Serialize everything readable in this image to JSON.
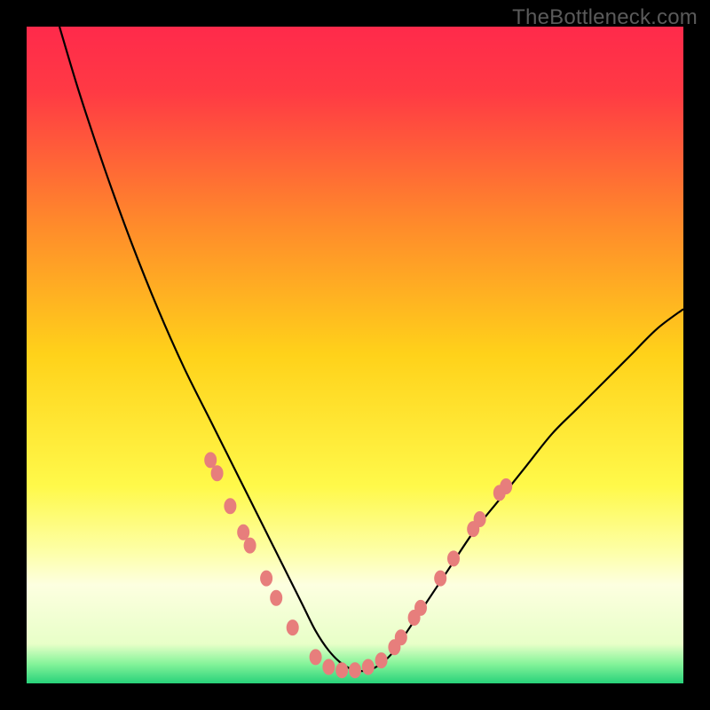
{
  "watermark": "TheBottleneck.com",
  "chart_data": {
    "type": "line",
    "title": "",
    "xlabel": "",
    "ylabel": "",
    "xlim": [
      0,
      100
    ],
    "ylim": [
      0,
      100
    ],
    "background_gradient_stops": [
      {
        "offset": 0.0,
        "color": "#ff2a4b"
      },
      {
        "offset": 0.1,
        "color": "#ff3a44"
      },
      {
        "offset": 0.3,
        "color": "#ff8a2b"
      },
      {
        "offset": 0.5,
        "color": "#ffd21a"
      },
      {
        "offset": 0.7,
        "color": "#fff94a"
      },
      {
        "offset": 0.8,
        "color": "#fdffa8"
      },
      {
        "offset": 0.85,
        "color": "#fdffe0"
      },
      {
        "offset": 0.94,
        "color": "#e8ffc8"
      },
      {
        "offset": 0.97,
        "color": "#86f49a"
      },
      {
        "offset": 1.0,
        "color": "#28d27a"
      }
    ],
    "series": [
      {
        "name": "curve",
        "stroke": "#000000",
        "stroke_width": 2.2,
        "x": [
          5,
          8,
          12,
          16,
          20,
          24,
          28,
          30,
          32,
          34,
          36,
          38,
          40,
          42,
          44,
          46,
          48,
          50,
          52,
          54,
          56,
          58,
          60,
          64,
          68,
          72,
          76,
          80,
          84,
          88,
          92,
          96,
          100
        ],
        "y": [
          100,
          90,
          78,
          67,
          57,
          48,
          40,
          36,
          32,
          28,
          24,
          20,
          16,
          12,
          8,
          5,
          3,
          2,
          2,
          3,
          5,
          8,
          11,
          17,
          23,
          28,
          33,
          38,
          42,
          46,
          50,
          54,
          57
        ]
      }
    ],
    "markers": {
      "name": "beads",
      "fill": "#e77e7c",
      "rx": 7,
      "ry": 9,
      "points": [
        {
          "x": 28.0,
          "y": 34.0
        },
        {
          "x": 29.0,
          "y": 32.0
        },
        {
          "x": 31.0,
          "y": 27.0
        },
        {
          "x": 33.0,
          "y": 23.0
        },
        {
          "x": 34.0,
          "y": 21.0
        },
        {
          "x": 36.5,
          "y": 16.0
        },
        {
          "x": 38.0,
          "y": 13.0
        },
        {
          "x": 40.5,
          "y": 8.5
        },
        {
          "x": 44.0,
          "y": 4.0
        },
        {
          "x": 46.0,
          "y": 2.5
        },
        {
          "x": 48.0,
          "y": 2.0
        },
        {
          "x": 50.0,
          "y": 2.0
        },
        {
          "x": 52.0,
          "y": 2.5
        },
        {
          "x": 54.0,
          "y": 3.5
        },
        {
          "x": 56.0,
          "y": 5.5
        },
        {
          "x": 57.0,
          "y": 7.0
        },
        {
          "x": 59.0,
          "y": 10.0
        },
        {
          "x": 60.0,
          "y": 11.5
        },
        {
          "x": 63.0,
          "y": 16.0
        },
        {
          "x": 65.0,
          "y": 19.0
        },
        {
          "x": 68.0,
          "y": 23.5
        },
        {
          "x": 69.0,
          "y": 25.0
        },
        {
          "x": 72.0,
          "y": 29.0
        },
        {
          "x": 73.0,
          "y": 30.0
        }
      ]
    }
  }
}
